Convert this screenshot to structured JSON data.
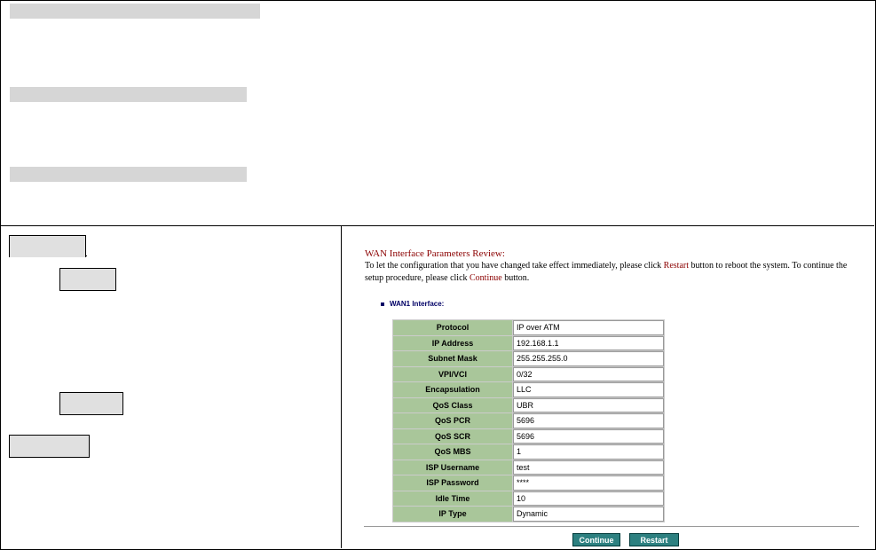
{
  "wan": {
    "title": "WAN Interface Parameters Review:",
    "desc_part1": "To let the configuration that you have changed take effect immediately,  please click ",
    "desc_restart": "Restart",
    "desc_part2": " button to reboot the system.  To continue the setup procedure, please click ",
    "desc_continue": "Continue",
    "desc_part3": " button.",
    "section_label": "WAN1 Interface:",
    "rows": [
      {
        "label": "Protocol",
        "value": "IP over ATM"
      },
      {
        "label": "IP Address",
        "value": "192.168.1.1"
      },
      {
        "label": "Subnet Mask",
        "value": "255.255.255.0"
      },
      {
        "label": "VPI/VCI",
        "value": "0/32"
      },
      {
        "label": "Encapsulation",
        "value": "LLC"
      },
      {
        "label": "QoS Class",
        "value": "UBR"
      },
      {
        "label": "QoS PCR",
        "value": "5696"
      },
      {
        "label": "QoS SCR",
        "value": "5696"
      },
      {
        "label": "QoS MBS",
        "value": "1"
      },
      {
        "label": "ISP Username",
        "value": "test"
      },
      {
        "label": "ISP Password",
        "value": "****"
      },
      {
        "label": "Idle Time",
        "value": "10"
      },
      {
        "label": "IP Type",
        "value": "Dynamic"
      }
    ],
    "continue_label": "Continue",
    "restart_label": "Restart"
  }
}
